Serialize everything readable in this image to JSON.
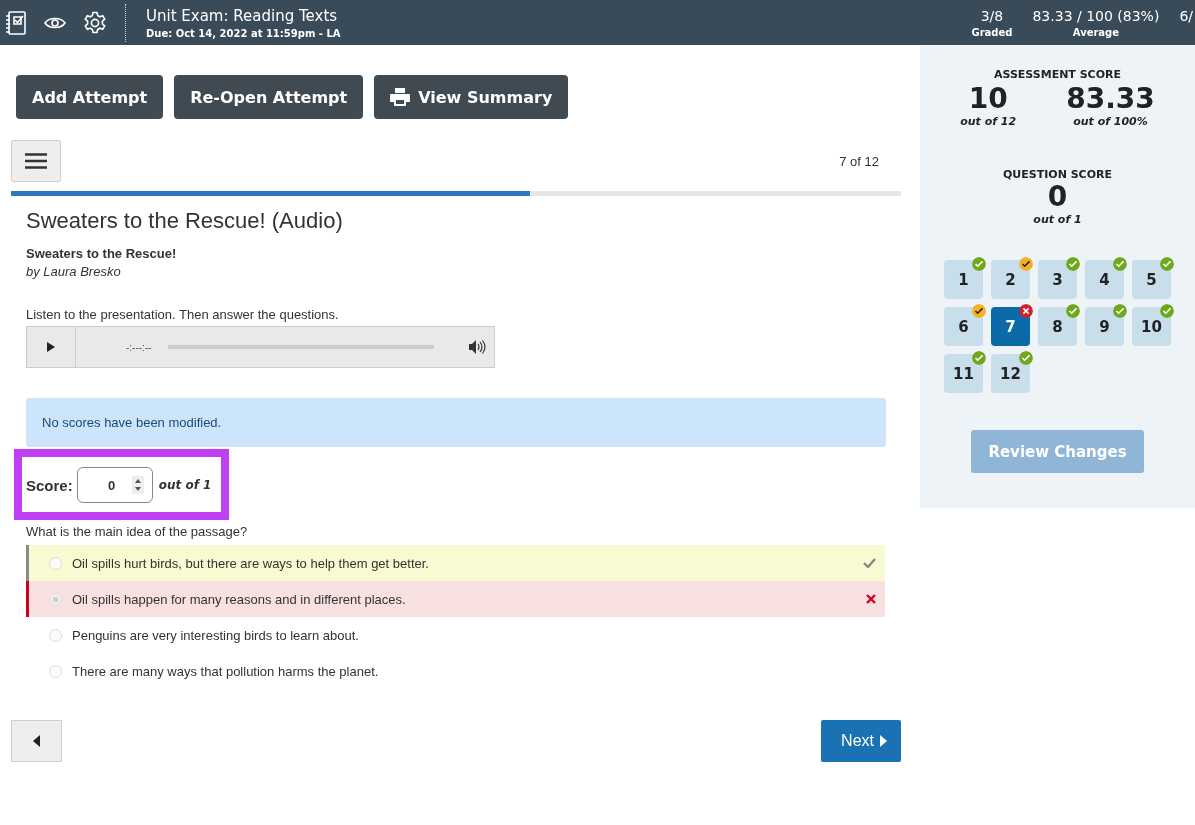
{
  "header": {
    "title": "Unit Exam: Reading Texts",
    "due": "Due: Oct 14, 2022 at 11:59pm - LA",
    "stats": [
      {
        "value": "3/8",
        "label": "Graded"
      },
      {
        "value": "83.33 / 100 (83%)",
        "label": "Average"
      },
      {
        "value": "6/"
      }
    ]
  },
  "actions": [
    {
      "label": "Add Attempt",
      "kind": "plain"
    },
    {
      "label": "Re-Open Attempt",
      "kind": "plain"
    },
    {
      "label": "View Summary",
      "kind": "print"
    }
  ],
  "question_nav": {
    "position": "7 of 12",
    "progress": {
      "level": 0.583
    }
  },
  "question": {
    "title": "Sweaters to the Rescue! (Audio)",
    "passage_title": "Sweaters to the Rescue!",
    "author": "by Laura Bresko",
    "instruction": "Listen to the presentation. Then answer the questions.",
    "audio_time": "-:---:--"
  },
  "alert": "No scores have been modified.",
  "score": {
    "label": "Score:",
    "value": "0",
    "out_of": "out of 1"
  },
  "prompt": "What is the main idea of the passage?",
  "answers": [
    {
      "text": "Oil spills hurt birds, but there are ways to help them get better.",
      "kind": "correct",
      "selected": false
    },
    {
      "text": "Oil spills happen for many reasons and in different places.",
      "kind": "incorrect",
      "selected": true
    },
    {
      "text": "Penguins are very interesting birds to learn about.",
      "kind": "plain",
      "selected": false
    },
    {
      "text": "There are many ways that pollution harms the planet.",
      "kind": "plain",
      "selected": false
    }
  ],
  "pager": {
    "next": "Next"
  },
  "sidebar": {
    "assessment_heading": "ASSESSMENT SCORE",
    "scores": [
      {
        "value": "10",
        "caption": "out of 12"
      },
      {
        "value": "83.33",
        "caption": "out of 100%"
      }
    ],
    "question_heading": "QUESTION SCORE",
    "question_score": {
      "value": "0",
      "caption": "out of 1"
    },
    "questions": [
      {
        "number": "1",
        "kind": "correct",
        "selected": false
      },
      {
        "number": "2",
        "kind": "partial",
        "selected": false
      },
      {
        "number": "3",
        "kind": "correct",
        "selected": false
      },
      {
        "number": "4",
        "kind": "correct",
        "selected": false
      },
      {
        "number": "5",
        "kind": "correct",
        "selected": false
      },
      {
        "number": "6",
        "kind": "partial",
        "selected": false
      },
      {
        "number": "7",
        "kind": "incorrect",
        "selected": true
      },
      {
        "number": "8",
        "kind": "correct",
        "selected": false
      },
      {
        "number": "9",
        "kind": "correct",
        "selected": false
      },
      {
        "number": "10",
        "kind": "correct",
        "selected": false
      },
      {
        "number": "11",
        "kind": "correct",
        "selected": false
      },
      {
        "number": "12",
        "kind": "correct",
        "selected": false
      }
    ],
    "review": {
      "label": "Review Changes",
      "disabled": true
    }
  }
}
